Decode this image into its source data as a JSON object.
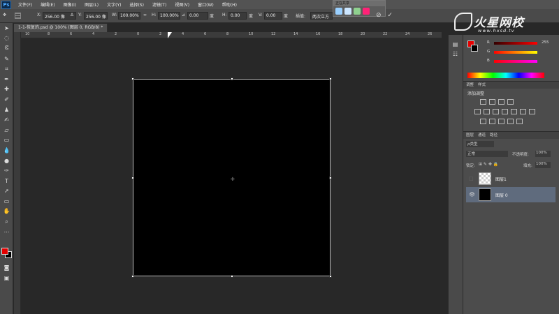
{
  "app": {
    "logo": "Ps"
  },
  "menu": [
    "文件(F)",
    "编辑(E)",
    "图像(I)",
    "图层(L)",
    "文字(Y)",
    "选择(S)",
    "滤镜(T)",
    "视图(V)",
    "窗口(W)",
    "帮助(H)"
  ],
  "options": {
    "x_label": "X:",
    "x_value": "256.00 像",
    "delta_icon": "Δ",
    "y_label": "Y:",
    "y_value": "256.00 像",
    "w_label": "W:",
    "w_value": "100.00%",
    "h_label": "H:",
    "h_value": "100.00%",
    "angle_value": "0.00",
    "angle_unit": "度",
    "hskew_label": "H:",
    "hskew_value": "0.00",
    "hskew_unit": "度",
    "vskew_label": "V:",
    "vskew_value": "0.00",
    "vskew_unit": "度",
    "interp_label": "插值:",
    "interp_value": "两次立方"
  },
  "popup": {
    "title": "正在共享"
  },
  "watermark": {
    "title": "火星网校",
    "url": "www.hxsd.tv"
  },
  "document": {
    "tab_title": "1-1-恢复的.psd @ 100% (图层 0, RGB/8) *"
  },
  "ruler": {
    "top_ticks": [
      "10",
      "8",
      "6",
      "4",
      "2",
      "0",
      "2",
      "4",
      "6",
      "8",
      "10",
      "12",
      "14",
      "16",
      "18",
      "20",
      "22",
      "24",
      "26"
    ]
  },
  "color_panel": {
    "r_label": "R",
    "g_label": "G",
    "b_label": "B",
    "r_value": "255",
    "fg_color": "#e40000",
    "bg_color": "#000000"
  },
  "adjustments": {
    "tabs": [
      "调整",
      "样式"
    ],
    "add_label": "添加调整"
  },
  "layers_panel": {
    "tabs": [
      "图层",
      "通道",
      "路径"
    ],
    "filter_value": "ρ类型",
    "blend_mode": "正常",
    "opacity_label": "不透明度:",
    "opacity_value": "100%",
    "lock_label": "锁定:",
    "fill_label": "填充:",
    "fill_value": "100%",
    "layers": [
      {
        "name": "图层1",
        "selected": false
      },
      {
        "name": "图层 0",
        "selected": true
      }
    ]
  }
}
